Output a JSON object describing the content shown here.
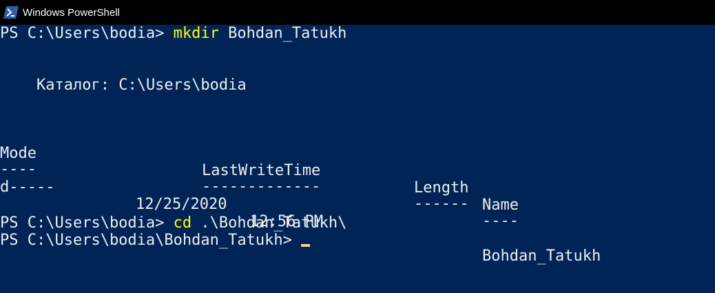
{
  "window": {
    "title": "Windows PowerShell",
    "icon": "powershell-icon"
  },
  "console": {
    "line1": {
      "prompt": "PS C:\\Users\\bodia>",
      "command": "mkdir",
      "argument": "Bohdan_Tatukh"
    },
    "directory_label": "Каталог: C:\\Users\\bodia",
    "table": {
      "headers": {
        "mode": "Mode",
        "lastwritetime": "LastWriteTime",
        "length": "Length",
        "name": "Name"
      },
      "underlines": {
        "mode": "----",
        "lastwritetime": "-------------",
        "length": "------",
        "name": "----"
      },
      "rows": [
        {
          "mode": "d-----",
          "date": "12/25/2020",
          "time": "12:56 PM",
          "length": "",
          "name": "Bohdan_Tatukh"
        }
      ]
    },
    "line2": {
      "prompt": "PS C:\\Users\\bodia>",
      "command": "cd",
      "argument": ".\\Bohdan_Tatukh\\"
    },
    "line3": {
      "prompt": "PS C:\\Users\\bodia\\Bohdan_Tatukh>"
    }
  },
  "colors": {
    "background": "#012456",
    "text": "#eeedf0",
    "command": "#ffff00",
    "cursor": "#fbd38a"
  }
}
